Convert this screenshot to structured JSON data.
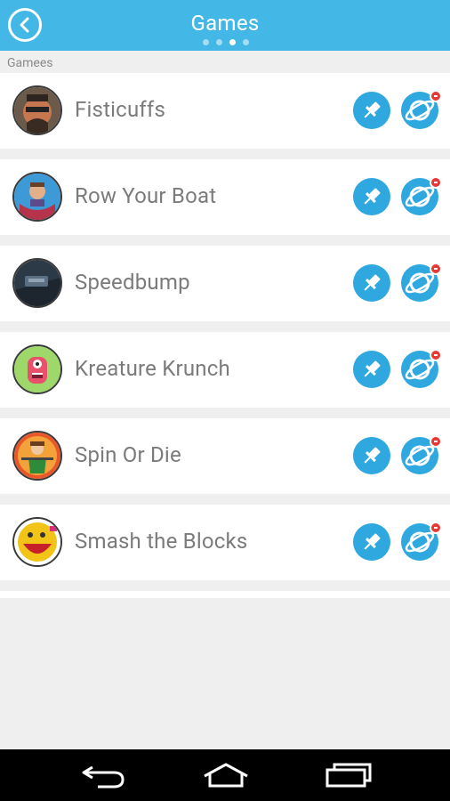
{
  "header": {
    "title": "Games",
    "page_indicator": {
      "count": 4,
      "active_index": 2
    }
  },
  "section": {
    "label": "Gamees"
  },
  "games": [
    {
      "name": "Fisticuffs",
      "icon": "fisticuffs-game-icon"
    },
    {
      "name": "Row Your Boat",
      "icon": "row-your-boat-game-icon"
    },
    {
      "name": "Speedbump",
      "icon": "speedbump-game-icon"
    },
    {
      "name": "Kreature Krunch",
      "icon": "kreature-krunch-game-icon"
    },
    {
      "name": "Spin Or Die",
      "icon": "spin-or-die-game-icon"
    },
    {
      "name": "Smash the Blocks",
      "icon": "smash-the-blocks-game-icon"
    }
  ],
  "row_actions": {
    "pin_icon": "pin-icon",
    "remove_icon": "planet-remove-icon"
  },
  "navbar": {
    "back_icon": "back-arrow-icon",
    "home_icon": "home-icon",
    "recents_icon": "recent-apps-icon"
  },
  "colors": {
    "accent": "#43b7e6",
    "button": "#2fa8e0",
    "badge": "#e53935"
  }
}
